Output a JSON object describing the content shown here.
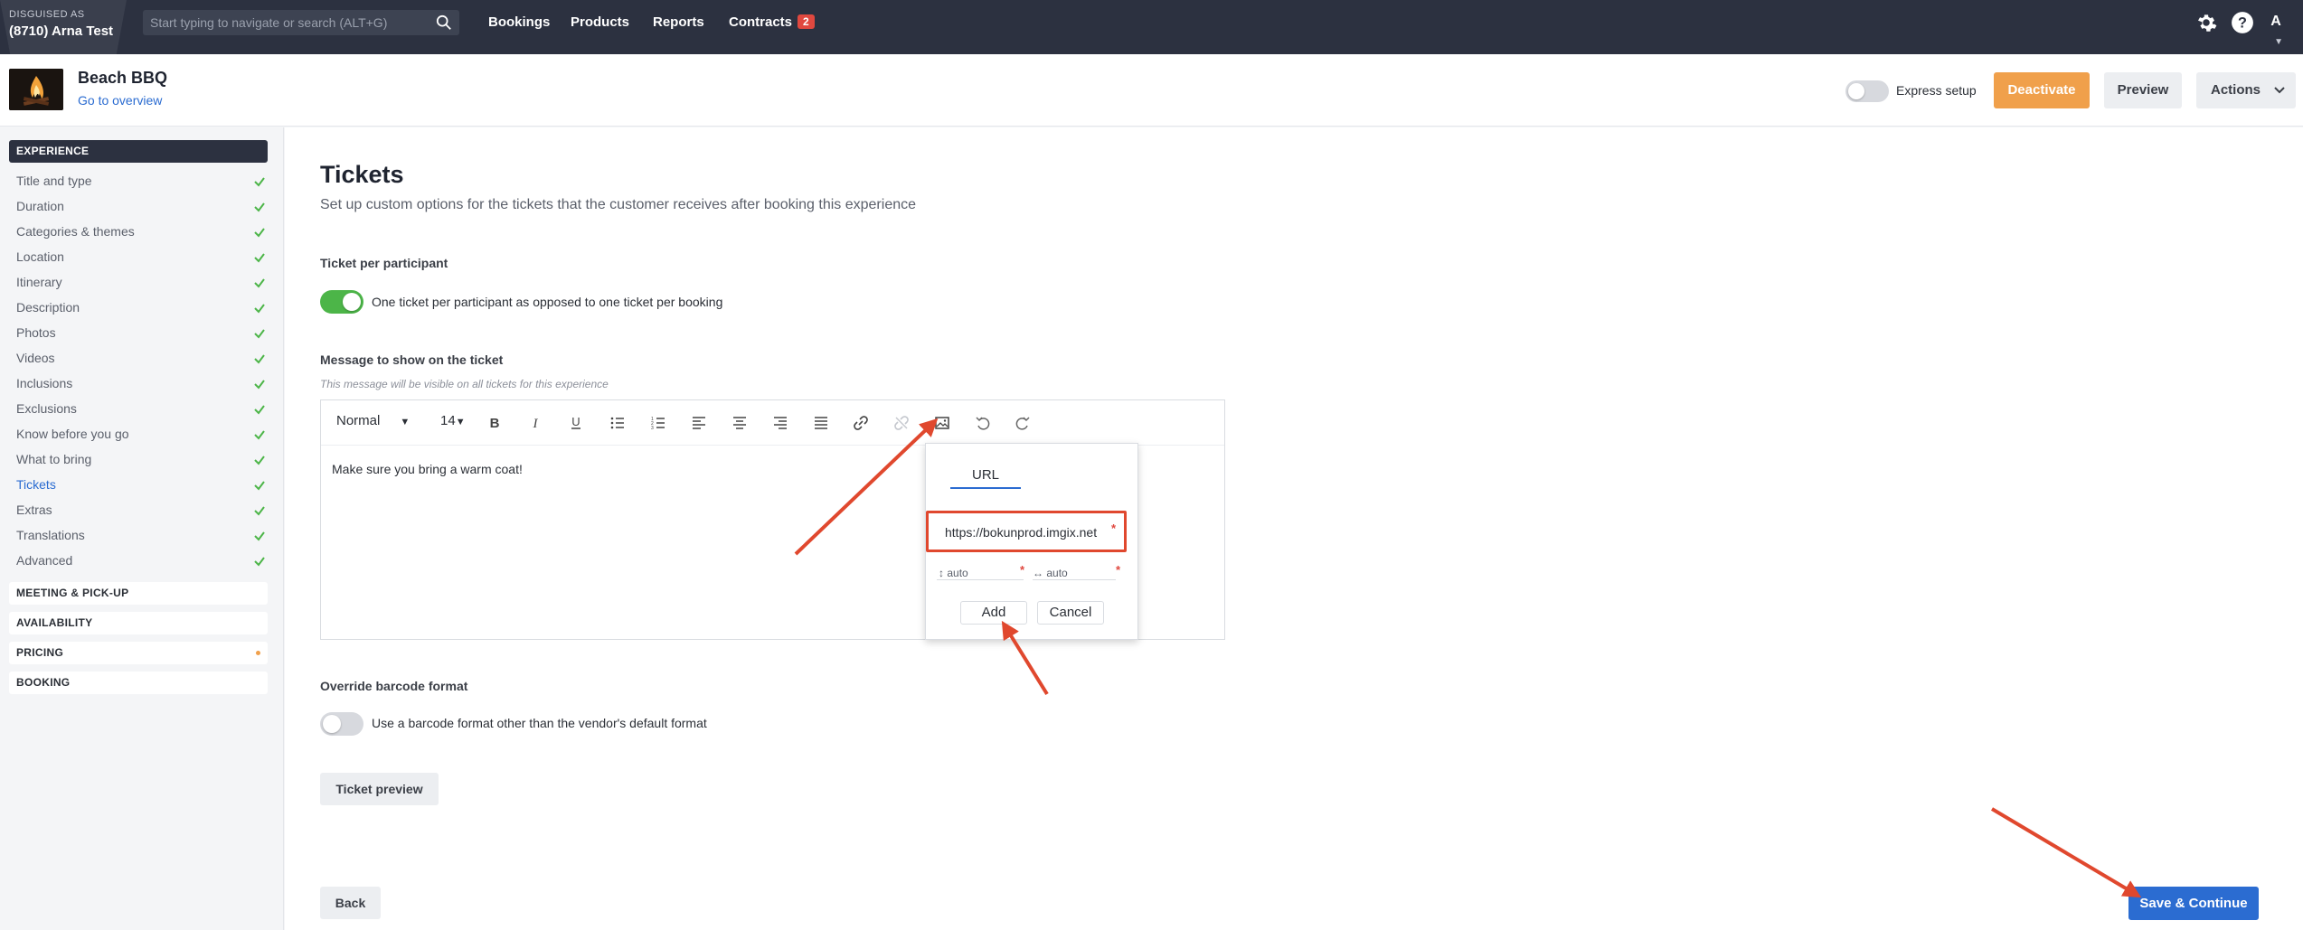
{
  "topbar": {
    "disguised_label": "DISGUISED AS",
    "disguised_name": "(8710) Arna Test",
    "search_placeholder": "Start typing to navigate or search (ALT+G)",
    "nav": [
      "Bookings",
      "Products",
      "Reports",
      "Contracts"
    ],
    "contracts_badge": "2",
    "avatar_letter": "A"
  },
  "header": {
    "product_title": "Beach BBQ",
    "overview_link": "Go to overview",
    "express_setup_label": "Express setup",
    "deactivate_label": "Deactivate",
    "preview_label": "Preview",
    "actions_label": "Actions"
  },
  "sidebar": {
    "experience_header": "EXPERIENCE",
    "items": [
      {
        "label": "Title and type"
      },
      {
        "label": "Duration"
      },
      {
        "label": "Categories & themes"
      },
      {
        "label": "Location"
      },
      {
        "label": "Itinerary"
      },
      {
        "label": "Description"
      },
      {
        "label": "Photos"
      },
      {
        "label": "Videos"
      },
      {
        "label": "Inclusions"
      },
      {
        "label": "Exclusions"
      },
      {
        "label": "Know before you go"
      },
      {
        "label": "What to bring"
      },
      {
        "label": "Tickets"
      },
      {
        "label": "Extras"
      },
      {
        "label": "Translations"
      },
      {
        "label": "Advanced"
      }
    ],
    "sections": [
      "MEETING & PICK-UP",
      "AVAILABILITY",
      "PRICING",
      "BOOKING"
    ]
  },
  "main": {
    "title": "Tickets",
    "subtitle": "Set up custom options for the tickets that the customer receives after booking this experience",
    "ticket_per_participant_label": "Ticket per participant",
    "ticket_per_participant_text": "One ticket per participant as opposed to one ticket per booking",
    "message_label": "Message to show on the ticket",
    "message_hint": "This message will be visible on all tickets for this experience",
    "editor": {
      "format_select": "Normal",
      "size_select": "14",
      "content": "Make sure you bring a warm coat!"
    },
    "image_popup": {
      "tab_label": "URL",
      "url_value": "https://bokunprod.imgix.net",
      "height_value": "auto",
      "width_value": "auto",
      "add_label": "Add",
      "cancel_label": "Cancel"
    },
    "barcode_label": "Override barcode format",
    "barcode_text": "Use a barcode format other than the vendor's default format",
    "ticket_preview_label": "Ticket preview",
    "back_label": "Back",
    "save_label": "Save & Continue"
  },
  "colors": {
    "topbar": "#2c3140",
    "accent_blue": "#2b6cd1",
    "deactivate_orange": "#f0a04b",
    "toggle_green": "#4cb548",
    "annotation_red": "#e0482e"
  }
}
